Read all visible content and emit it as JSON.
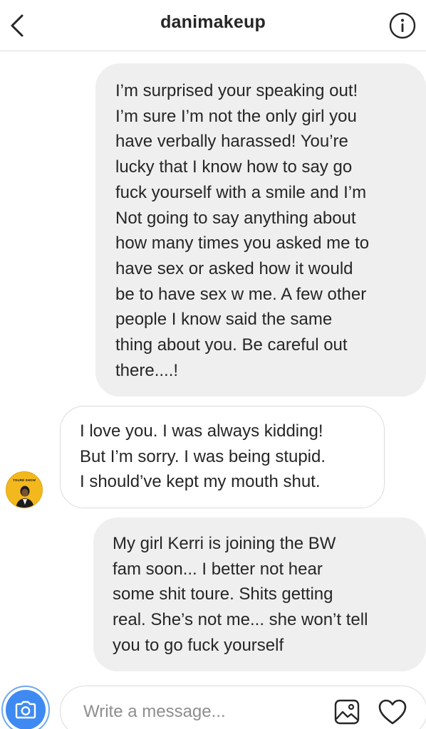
{
  "header": {
    "title": "danimakeup",
    "back_icon": "chevron-left-icon",
    "info_icon": "info-icon"
  },
  "messages": [
    {
      "direction": "outgoing",
      "text": "I’m surprised your speaking out!\nI’m sure I’m not the only girl you\nhave verbally harassed! You’re\nlucky that I know how to say go\nfuck yourself with a smile and I’m\nNot going to say anything about\nhow many times you asked me to\nhave sex or asked how it would\nbe to have sex w me. A few other\npeople I know said the same\nthing about you. Be careful out\nthere....!"
    },
    {
      "direction": "incoming",
      "text": "I love you. I was always kidding!\nBut I’m sorry. I was being stupid.\nI should’ve kept my mouth shut.",
      "avatar_label": "TOURÉ SHOW"
    },
    {
      "direction": "outgoing",
      "text": "My girl Kerri is joining the BW\nfam soon... I better not hear\nsome shit toure. Shits getting\nreal. She’s not me... she won’t tell\nyou to go fuck yourself"
    }
  ],
  "composer": {
    "placeholder": "Write a message...",
    "value": "",
    "camera_icon": "camera-icon",
    "gallery_icon": "image-gallery-icon",
    "heart_icon": "heart-icon"
  },
  "colors": {
    "outgoing_bubble": "#efefef",
    "incoming_border": "#dbdbdb",
    "camera_blue": "#3e8af2",
    "text": "#262626",
    "placeholder": "#8e8e8e",
    "avatar_bg": "#f2b81e"
  }
}
